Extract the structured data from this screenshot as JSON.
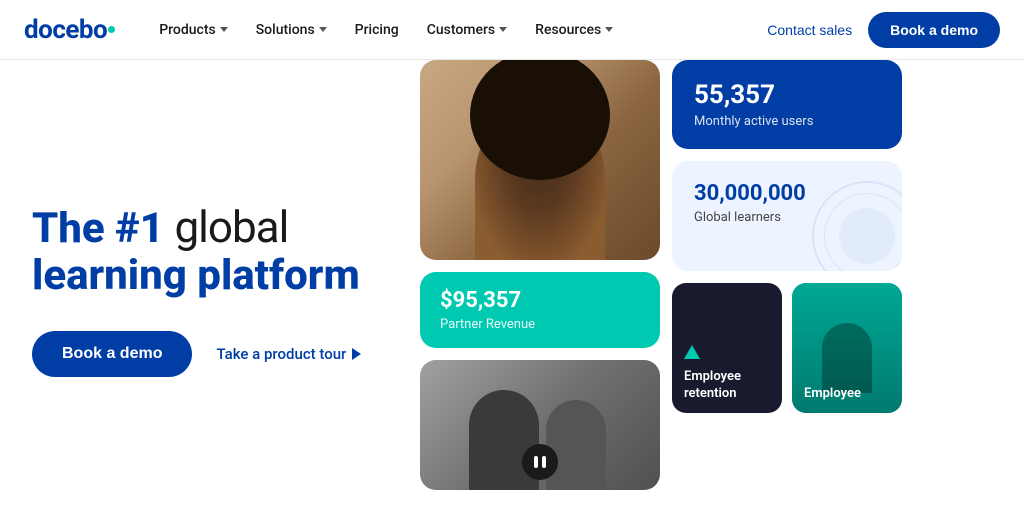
{
  "brand": {
    "name": "docebo",
    "logo_dot_color": "#00C9B1"
  },
  "nav": {
    "items": [
      {
        "label": "Products",
        "has_dropdown": true
      },
      {
        "label": "Solutions",
        "has_dropdown": true
      },
      {
        "label": "Pricing",
        "has_dropdown": false
      },
      {
        "label": "Customers",
        "has_dropdown": true
      },
      {
        "label": "Resources",
        "has_dropdown": true
      }
    ],
    "contact_sales_label": "Contact sales",
    "book_demo_label": "Book a demo"
  },
  "hero": {
    "heading_line1": "The #1 ",
    "heading_global": "global",
    "heading_line2": "learning platform",
    "book_demo_label": "Book a demo",
    "product_tour_label": "Take a product tour"
  },
  "stats": {
    "active_users_number": "55,357",
    "active_users_label": "Monthly active users",
    "global_learners_number": "30,000,000",
    "global_learners_label": "Global learners",
    "revenue_amount": "$95,357",
    "revenue_label": "Partner Revenue"
  },
  "cards": {
    "employee_retention_label": "Employee retention",
    "card2_label": "Employee"
  }
}
